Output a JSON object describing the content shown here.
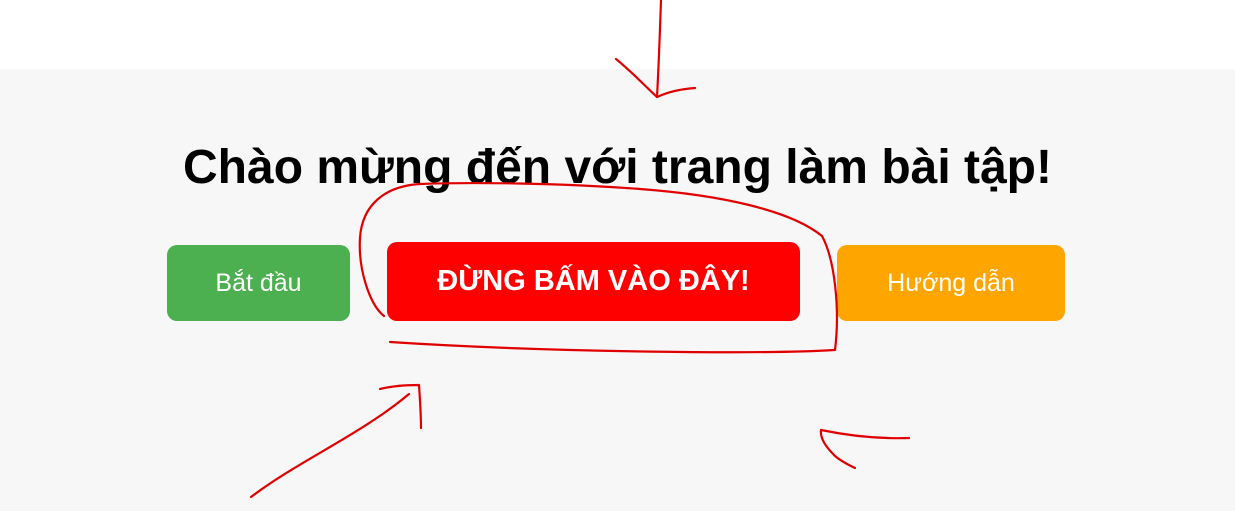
{
  "colors": {
    "page_background": "#f7f7f7",
    "top_strip": "#ffffff",
    "title_text": "#000000",
    "start_button": "#4caf50",
    "danger_button": "#ff0000",
    "guide_button": "#ffa500",
    "button_text": "#ffffff",
    "annotation_ink": "#e00000"
  },
  "main": {
    "title": "Chào mừng đến với trang làm bài tập!",
    "buttons": {
      "start_label": "Bắt đầu",
      "danger_label": "ĐỪNG BẤM VÀO ĐÂY!",
      "guide_label": "Hướng dẫn"
    }
  },
  "annotations": {
    "icons": [
      "hand-drawn-circle-icon",
      "arrow-down-icon",
      "arrow-up-right-icon",
      "arrow-left-icon"
    ]
  }
}
